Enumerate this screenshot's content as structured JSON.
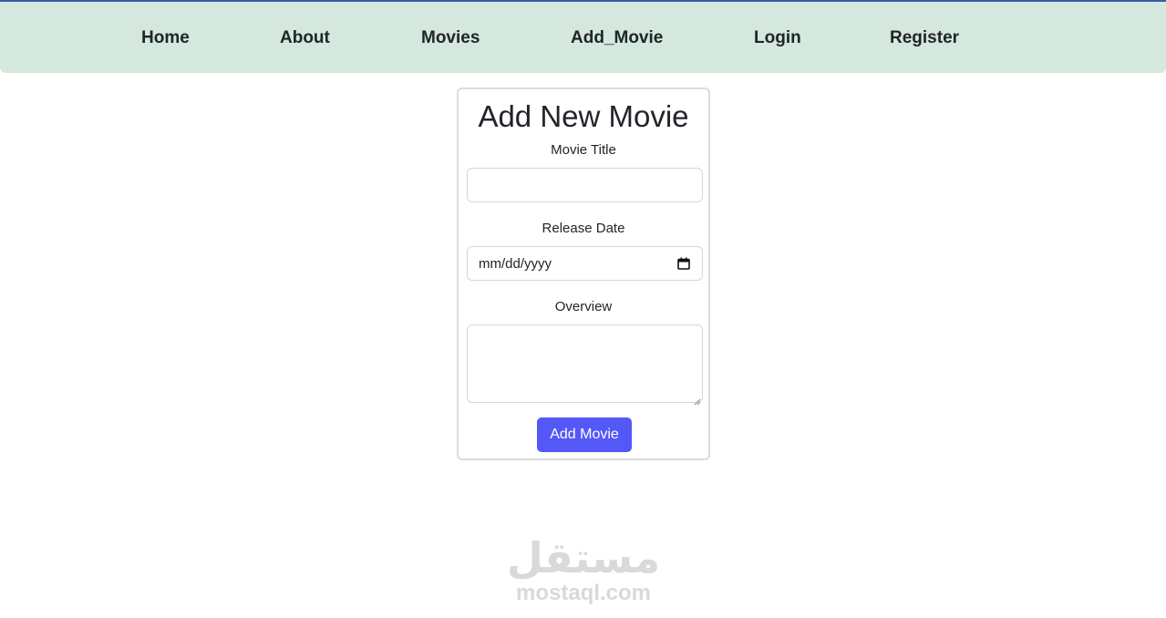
{
  "nav": {
    "items": [
      {
        "label": "Home"
      },
      {
        "label": "About"
      },
      {
        "label": "Movies"
      },
      {
        "label": "Add_Movie"
      },
      {
        "label": "Login"
      },
      {
        "label": "Register"
      }
    ]
  },
  "form": {
    "title": "Add New Movie",
    "movie_title_label": "Movie Title",
    "movie_title_value": "",
    "release_date_label": "Release Date",
    "release_date_placeholder": "mm/dd/yyyy",
    "overview_label": "Overview",
    "overview_value": "",
    "submit_label": "Add Movie"
  },
  "watermark": {
    "arabic": "مستقل",
    "latin": "mostaql.com"
  },
  "colors": {
    "navbar_bg": "#d4e8dd",
    "navbar_top_border": "#3b5ba9",
    "submit_bg": "#5458f7"
  }
}
